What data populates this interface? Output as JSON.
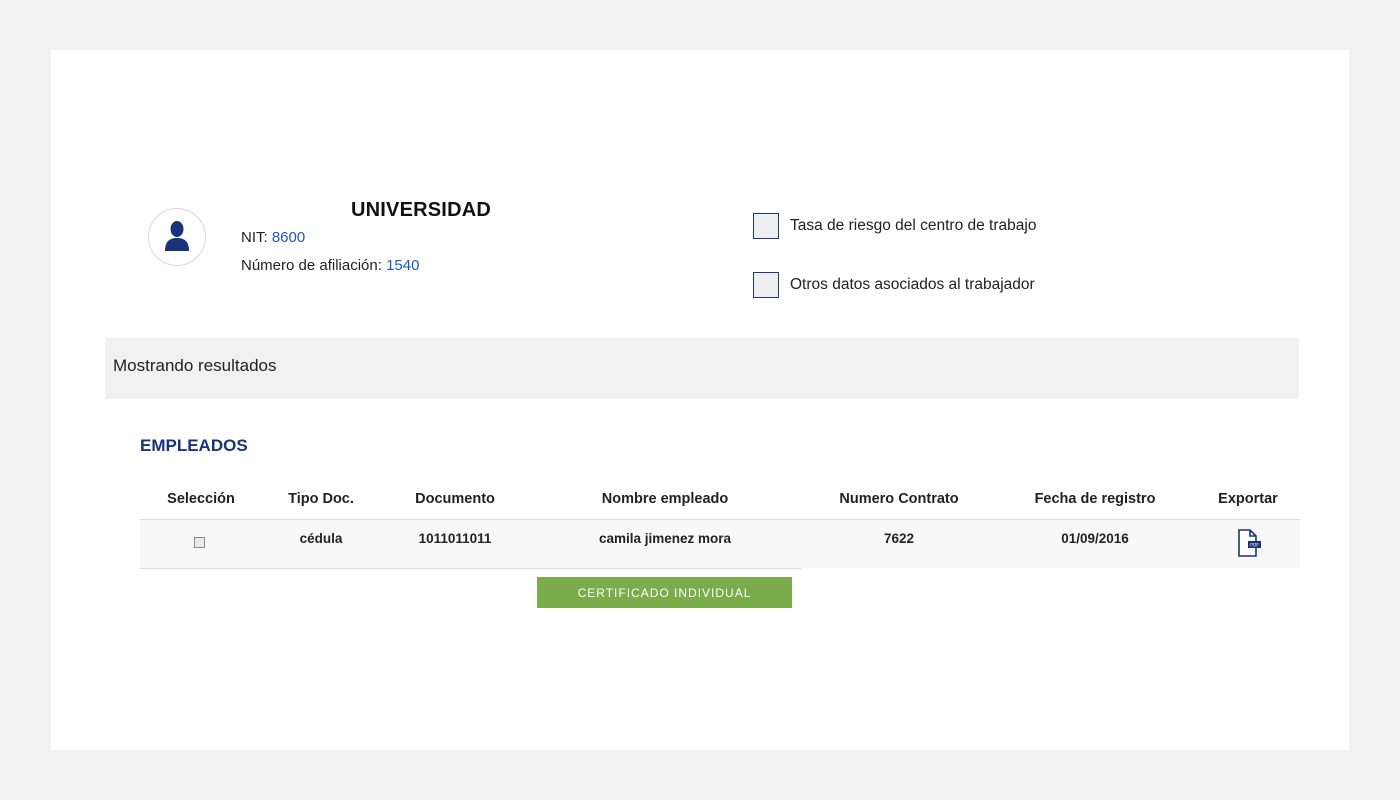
{
  "company": {
    "name": "UNIVERSIDAD",
    "nit_label": "NIT:",
    "nit_value": "8600",
    "affiliation_label": "Número de afiliación:",
    "affiliation_value": "1540"
  },
  "options": [
    {
      "label": "Tasa de riesgo del centro de trabajo",
      "checked": false
    },
    {
      "label": "Otros datos asociados al trabajador",
      "checked": false
    }
  ],
  "results": {
    "label": "Mostrando resultados"
  },
  "section": {
    "title": "EMPLEADOS"
  },
  "table": {
    "headers": [
      "Selección",
      "Tipo Doc.",
      "Documento",
      "Nombre empleado",
      "Numero Contrato",
      "Fecha de registro",
      "Exportar"
    ],
    "rows": [
      {
        "selected": false,
        "tipo_doc": "cédula",
        "documento": "1011011011",
        "nombre": "camila jimenez mora",
        "numero_contrato": "7622",
        "fecha_registro": "01/09/2016",
        "export_icon": "pdf-file-icon"
      }
    ]
  },
  "actions": {
    "certificate_button": "CERTIFICADO INDIVIDUAL"
  },
  "colors": {
    "accent_blue": "#17337a",
    "link_blue": "#1a56c4",
    "button_green": "#7aac4b",
    "page_bg": "#f1f1f1"
  }
}
